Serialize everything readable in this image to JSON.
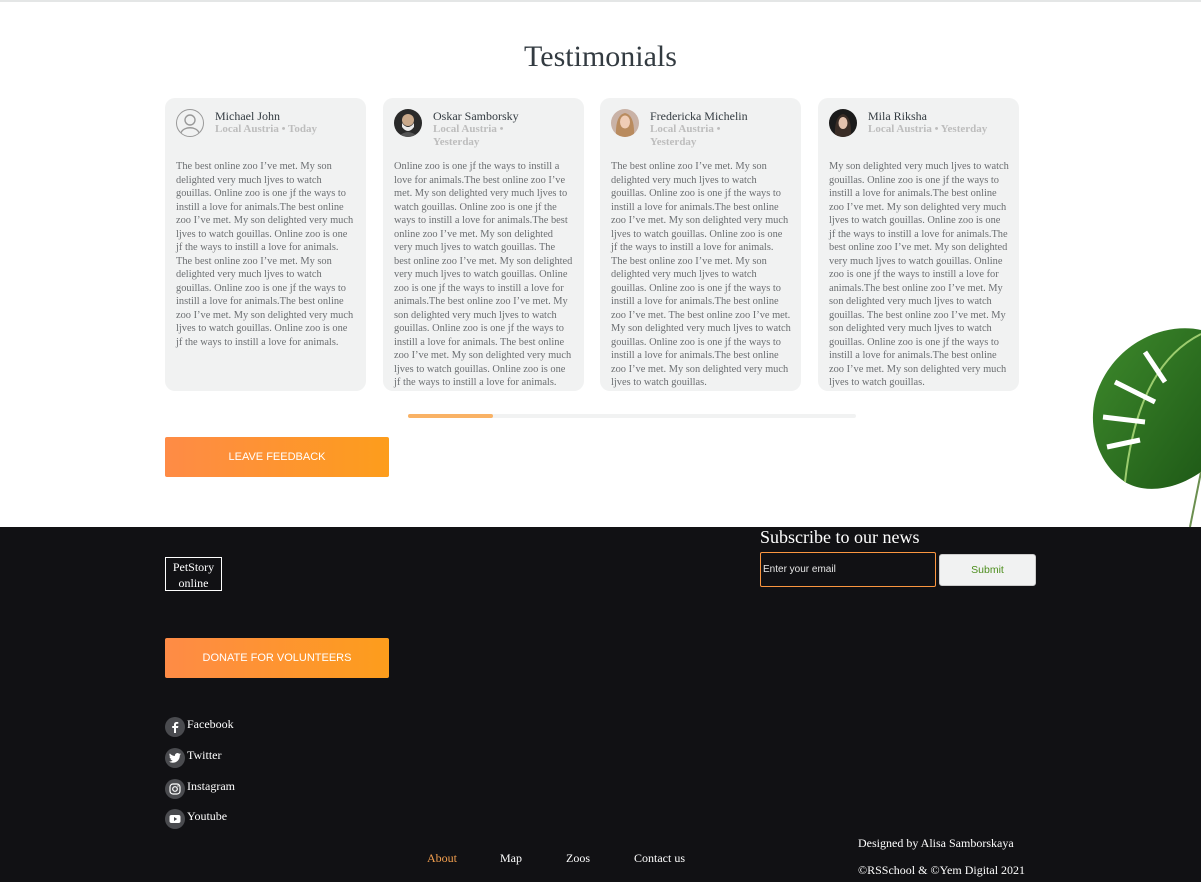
{
  "testimonials": {
    "title": "Testimonials",
    "cards": [
      {
        "name": "Michael John",
        "meta": "Local Austria • Today",
        "avatar": "default-user-icon",
        "text": "The best online zoo I’ve met. My son delighted very much ljves to watch gouillas. Online zoo is one jf the ways to instill a love for animals.The best online zoo I’ve met. My son delighted very much ljves to watch gouillas. Online zoo is one jf the ways to instill a love for animals. The best online zoo I’ve met. My son delighted very much ljves to watch gouillas. Online zoo is one jf the ways to instill a love for animals.The best online zoo I’ve met. My son delighted very much ljves to watch gouillas. Online zoo is one jf the ways to instill a love for animals."
      },
      {
        "name": "Oskar Samborsky",
        "meta": "Local Austria • Yesterday",
        "avatar": "photo-man",
        "text": "Online zoo is one jf the ways to instill a love for animals.The best online zoo I’ve met. My son delighted very much ljves to watch gouillas. Online zoo is one jf the ways to instill a love for animals.The best online zoo I’ve met. My son delighted very much ljves to watch gouillas. The best online zoo I’ve met. My son delighted very much ljves to watch gouillas. Online zoo is one jf the ways to instill a love for animals.The best online zoo I’ve met. My son delighted very much ljves to watch gouillas. Online zoo is one jf the ways to instill a love for animals. The best online zoo I’ve met. My son delighted very much ljves to watch gouillas. Online zoo is one jf the ways to instill a love for animals."
      },
      {
        "name": "Fredericka Michelin",
        "meta": "Local Austria • Yesterday",
        "avatar": "photo-woman-blonde",
        "text": "The best online zoo I’ve met. My son delighted very much ljves to watch gouillas. Online zoo is one jf the ways to instill a love for animals.The best online zoo I’ve met. My son delighted very much ljves to watch gouillas. Online zoo is one jf the ways to instill a love for animals. The best online zoo I’ve met. My son delighted very much ljves to watch gouillas. Online zoo is one jf the ways to instill a love for animals.The best online zoo I’ve met. The best online zoo I’ve met. My son delighted very much ljves to watch gouillas. Online zoo is one jf the ways to instill a love for animals.The best online zoo I’ve met. My son delighted very much ljves to watch gouillas."
      },
      {
        "name": "Mila Riksha",
        "meta": "Local Austria • Yesterday",
        "avatar": "photo-woman-dark",
        "text": "My son delighted very much ljves to watch gouillas. Online zoo is one jf the ways to instill a love for animals.The best online zoo I’ve met. My son delighted very much ljves to watch gouillas. Online zoo is one jf the ways to instill a love for animals.The best online zoo I’ve met. My son delighted very much ljves to watch gouillas. Online zoo is one jf the ways to instill a love for animals.The best online zoo I’ve met. My son delighted very much ljves to watch gouillas. The best online zoo I’ve met. My son delighted very much ljves to watch gouillas. Online zoo is one jf the ways to instill a love for animals.The best online zoo I’ve met. My son delighted very much ljves to watch gouillas."
      }
    ],
    "scroll_progress": 0.19,
    "leave_feedback_label": "LEAVE FEEDBACK"
  },
  "footer": {
    "logo_line1": "PetStory",
    "logo_line2": "online",
    "donate_label": "DONATE FOR VOLUNTEERS",
    "subscribe_title": "Subscribe to our news",
    "email_placeholder": "Enter your email",
    "submit_label": "Submit",
    "socials": [
      {
        "label": "Facebook",
        "icon": "facebook-icon"
      },
      {
        "label": "Twitter",
        "icon": "twitter-icon"
      },
      {
        "label": "Instagram",
        "icon": "instagram-icon"
      },
      {
        "label": "Youtube",
        "icon": "youtube-icon"
      }
    ],
    "nav": [
      {
        "label": "About",
        "active": true
      },
      {
        "label": "Map",
        "active": false
      },
      {
        "label": "Zoos",
        "active": false
      },
      {
        "label": "Contact us",
        "active": false
      }
    ],
    "designed_by": "Designed by Alisa Samborskaya",
    "copyright": "©RSSchool & ©Yem Digital 2021"
  },
  "colors": {
    "accent": "#fd9d1c",
    "accent_start": "#fe8b46",
    "footer_bg": "#111114",
    "card_bg": "#f1f2f2",
    "nav_active": "#f4a04f",
    "submit_text": "#4d8e1d"
  }
}
